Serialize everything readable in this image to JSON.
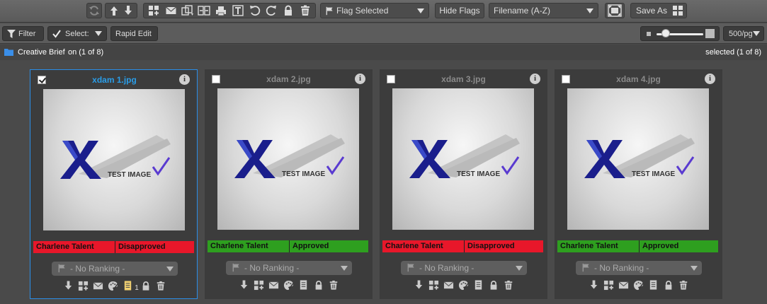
{
  "toolbar": {
    "flag_dropdown": "Flag Selected",
    "hide_flags": "Hide Flags",
    "sort_dropdown": "Filename (A-Z)",
    "save_as": "Save As"
  },
  "bar2": {
    "filter": "Filter",
    "select": "Select:",
    "rapid_edit": "Rapid Edit",
    "per_page": "500/pg",
    "zoom_level": 0.2
  },
  "breadcrumb": {
    "folder": "Creative Brief",
    "count": "on (1 of 8)",
    "selected": "selected (1 of 8)"
  },
  "thumb_text": "TEST IMAGE",
  "cards": [
    {
      "filename": "xdam 1.jpg",
      "checked": true,
      "user": "Charlene Talent",
      "status": "Disapproved",
      "status_color": "#e8172a",
      "ranking": "- No Ranking -",
      "note_count": "1"
    },
    {
      "filename": "xdam 2.jpg",
      "checked": false,
      "user": "Charlene Talent",
      "status": "Approved",
      "status_color": "#2e9f1f",
      "ranking": "- No Ranking -"
    },
    {
      "filename": "xdam 3.jpg",
      "checked": false,
      "user": "Charlene Talent",
      "status": "Disapproved",
      "status_color": "#e8172a",
      "ranking": "- No Ranking -"
    },
    {
      "filename": "xdam 4.jpg",
      "checked": false,
      "user": "Charlene Talent",
      "status": "Approved",
      "status_color": "#2e9f1f",
      "ranking": "- No Ranking -"
    }
  ],
  "colors": {
    "selected_border": "#2a8ee8",
    "disapproved": "#e8172a",
    "approved": "#2e9f1f"
  }
}
